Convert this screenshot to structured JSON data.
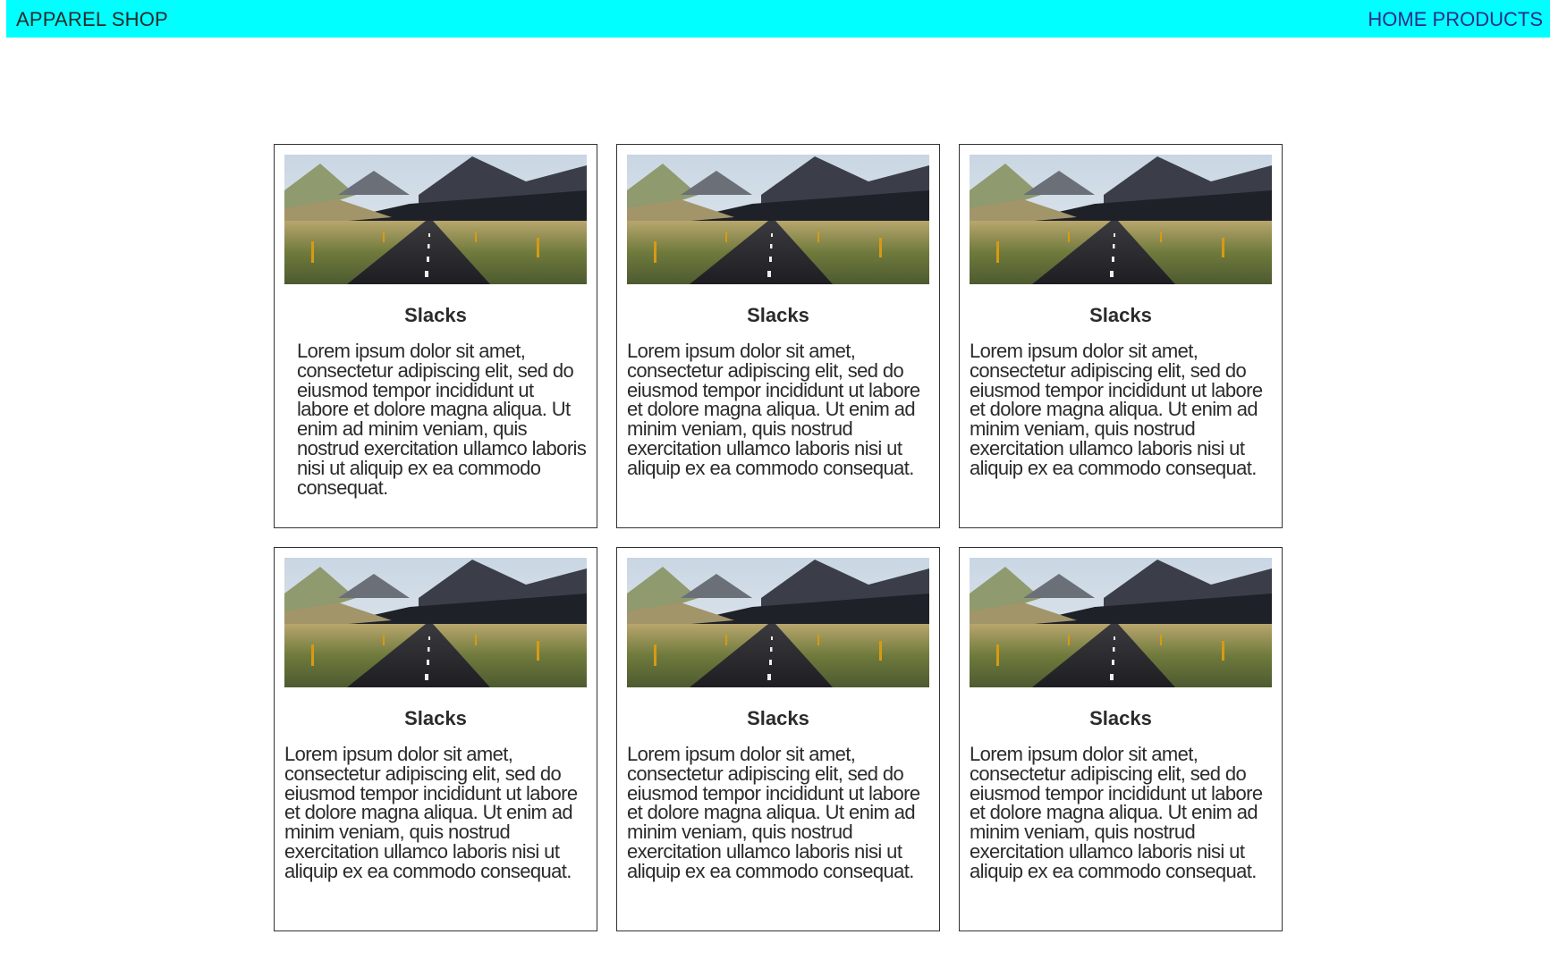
{
  "header": {
    "brand": "APPAREL SHOP",
    "nav": [
      "HOME",
      "PRODUCTS"
    ]
  },
  "colors": {
    "navbar_bg": "#00ffff",
    "nav_link": "#2c2c8a"
  },
  "products": [
    {
      "title": "Slacks",
      "image": "mountain-road-image",
      "description": "Lorem ipsum dolor sit amet, consectetur adipiscing elit, sed do eiusmod tempor incididunt ut labore et dolore magna aliqua. Ut enim ad minim veniam, quis nostrud exercitation ullamco laboris nisi ut aliquip ex ea commodo consequat."
    },
    {
      "title": "Slacks",
      "image": "mountain-road-image",
      "description": "Lorem ipsum dolor sit amet, consectetur adipiscing elit, sed do eiusmod tempor incididunt ut labore et dolore magna aliqua. Ut enim ad minim veniam, quis nostrud exercitation ullamco laboris nisi ut aliquip ex ea commodo consequat."
    },
    {
      "title": "Slacks",
      "image": "mountain-road-image",
      "description": "Lorem ipsum dolor sit amet, consectetur adipiscing elit, sed do eiusmod tempor incididunt ut labore et dolore magna aliqua. Ut enim ad minim veniam, quis nostrud exercitation ullamco laboris nisi ut aliquip ex ea commodo consequat."
    },
    {
      "title": "Slacks",
      "image": "mountain-road-image",
      "description": "Lorem ipsum dolor sit amet, consectetur adipiscing elit, sed do eiusmod tempor incididunt ut labore et dolore magna aliqua. Ut enim ad minim veniam, quis nostrud exercitation ullamco laboris nisi ut aliquip ex ea commodo consequat."
    },
    {
      "title": "Slacks",
      "image": "mountain-road-image",
      "description": "Lorem ipsum dolor sit amet, consectetur adipiscing elit, sed do eiusmod tempor incididunt ut labore et dolore magna aliqua. Ut enim ad minim veniam, quis nostrud exercitation ullamco laboris nisi ut aliquip ex ea commodo consequat."
    },
    {
      "title": "Slacks",
      "image": "mountain-road-image",
      "description": "Lorem ipsum dolor sit amet, consectetur adipiscing elit, sed do eiusmod tempor incididunt ut labore et dolore magna aliqua. Ut enim ad minim veniam, quis nostrud exercitation ullamco laboris nisi ut aliquip ex ea commodo consequat."
    }
  ]
}
